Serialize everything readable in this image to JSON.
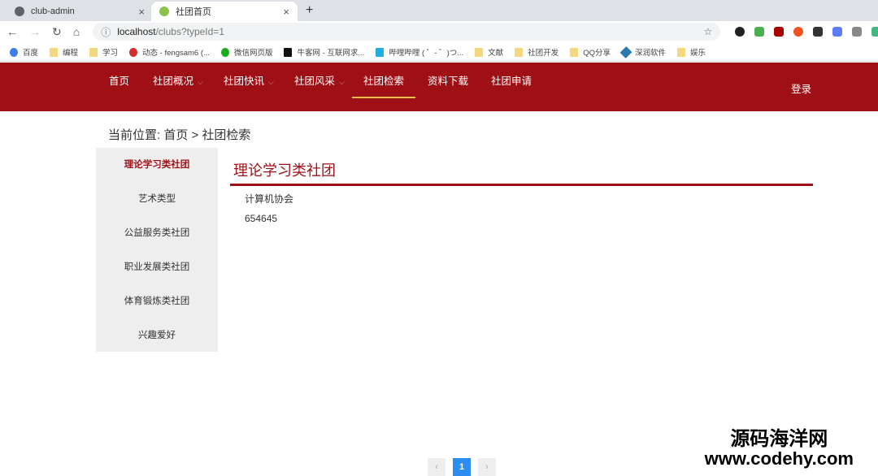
{
  "browser": {
    "tabs": [
      {
        "title": "club-admin",
        "close": "×"
      },
      {
        "title": "社团首页",
        "close": "×"
      }
    ],
    "new_tab": "+",
    "url_host": "localhost",
    "url_path": "/clubs?typeId=1",
    "bookmarks": [
      "百度",
      "编程",
      "学习",
      "动态 - fengsam6 (...",
      "微信网页版",
      "牛客网 - 互联网求...",
      "哔哩哔哩 ( ゜- ゜)つ...",
      "文献",
      "社团开发",
      "QQ分享",
      "深润软件",
      "娱乐"
    ]
  },
  "nav": {
    "items": [
      {
        "label": "首页"
      },
      {
        "label": "社团概况",
        "chev": "⌵"
      },
      {
        "label": "社团快讯",
        "chev": "⌵"
      },
      {
        "label": "社团风采",
        "chev": "⌵"
      },
      {
        "label": "社团检索"
      },
      {
        "label": "资料下载"
      },
      {
        "label": "社团申请"
      }
    ],
    "login": "登录"
  },
  "breadcrumb": "当前位置: 首页 > 社团检索",
  "sidebar": [
    "理论学习类社团",
    "艺术类型",
    "公益服务类社团",
    "职业发展类社团",
    "体育锻炼类社团",
    "兴趣爱好"
  ],
  "content": {
    "title": "理论学习类社团",
    "rows": [
      "计算机协会",
      "654645"
    ]
  },
  "pager": {
    "prev": "‹",
    "current": "1",
    "next": "›"
  },
  "watermark": {
    "line1": "源码海洋网",
    "line2": "www.codehy.com"
  }
}
